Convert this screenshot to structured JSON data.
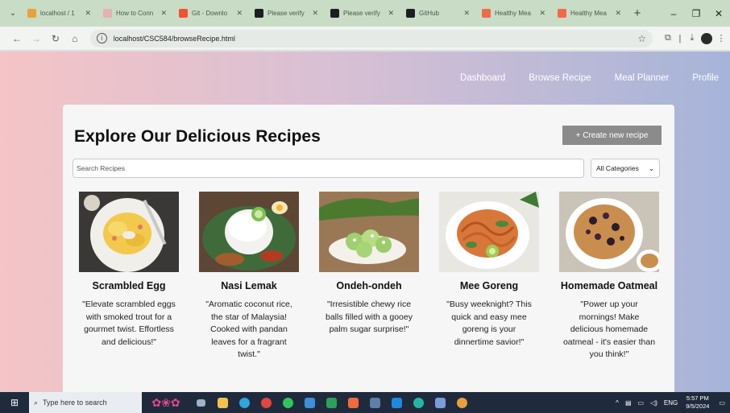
{
  "browser": {
    "tabs": [
      {
        "title": "localhost / 1",
        "color": "#e9a13b"
      },
      {
        "title": "How to Conn",
        "color": "#e6b1b1"
      },
      {
        "title": "Git - Downlo",
        "color": "#f05133"
      },
      {
        "title": "Please verify",
        "color": "#1b1f23"
      },
      {
        "title": "Please verify",
        "color": "#1b1f23"
      },
      {
        "title": "GitHub",
        "color": "#1b1f23"
      },
      {
        "title": "Healthy Mea",
        "color": "#f06a4a"
      },
      {
        "title": "Healthy Mea",
        "color": "#f06a4a"
      }
    ],
    "url": "localhost/CSC584/browseRecipe.html"
  },
  "nav": {
    "items": [
      "Dashboard",
      "Browse Recipe",
      "Meal Planner",
      "Profile"
    ]
  },
  "main": {
    "title": "Explore Our Delicious Recipes",
    "create_label": "+ Create new recipe",
    "search_placeholder": "Search Recipes",
    "category_selected": "All Categories"
  },
  "recipes": [
    {
      "name": "Scrambled Egg",
      "description": "\"Elevate scrambled eggs with smoked trout for a gourmet twist. Effortless and delicious!\""
    },
    {
      "name": "Nasi Lemak",
      "description": "\"Aromatic coconut rice, the star of Malaysia! Cooked with pandan leaves for a fragrant twist.\""
    },
    {
      "name": "Ondeh-ondeh",
      "description": "\"Irresistible chewy rice balls filled with a gooey palm sugar surprise!\""
    },
    {
      "name": "Mee Goreng",
      "description": "\"Busy weeknight? This quick and easy mee goreng is your dinnertime savior!\""
    },
    {
      "name": "Homemade Oatmeal",
      "description": "\"Power up your mornings! Make delicious homemade oatmeal - it's easier than you think!\""
    }
  ],
  "taskbar": {
    "search_placeholder": "Type here to search",
    "lang": "ENG",
    "time": "5:57 PM",
    "date": "9/5/2024"
  },
  "colors": {
    "accent_button": "#8b8b8b",
    "taskbar": "#1f2b3c",
    "gradient_left": "#f4c4c6",
    "gradient_right": "#a6b4d9"
  }
}
